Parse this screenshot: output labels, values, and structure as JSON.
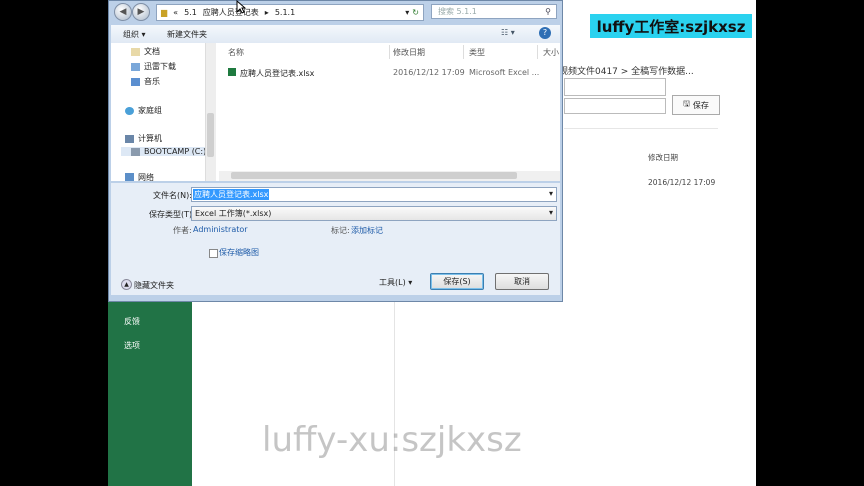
{
  "backstage": {
    "side_items": [
      "反馈",
      "选项"
    ],
    "path": "全视频文件0417 > 全稿写作数据...",
    "save_label": "保存",
    "col_modified": "修改日期",
    "file_date": "2016/12/12 17:09"
  },
  "dialog": {
    "address": [
      "5.1",
      "应聘人员登记表",
      "5.1.1"
    ],
    "search_placeholder": "搜索 5.1.1",
    "toolbar": {
      "organize": "组织 ▾",
      "new_folder": "新建文件夹"
    },
    "sidebar": [
      "文档",
      "迅雷下载",
      "音乐",
      "家庭组",
      "计算机",
      "BOOTCAMP (C:)",
      "网络"
    ],
    "columns": [
      "名称",
      "修改日期",
      "类型",
      "大小"
    ],
    "files": [
      {
        "name": "应聘人员登记表.xlsx",
        "modified": "2016/12/12 17:09",
        "type": "Microsoft Excel ..."
      }
    ],
    "filename_label": "文件名(N):",
    "filename_value": "应聘人员登记表.xlsx",
    "filetype_label": "保存类型(T):",
    "filetype_value": "Excel 工作簿(*.xlsx)",
    "author_label": "作者:",
    "author_value": "Administrator",
    "tags_label": "标记:",
    "tags_value": "添加标记",
    "thumbnail_label": "保存缩略图",
    "hide_folders": "隐藏文件夹",
    "tools": "工具(L)",
    "save": "保存(S)",
    "cancel": "取消"
  },
  "overlay": {
    "brand": "luffy工作室:szjkxsz",
    "watermark": "luffy-xu:szjkxsz"
  },
  "colors": {
    "excel_green": "#217346",
    "brand_bg": "#2ad2ef",
    "selection": "#3399ff"
  }
}
